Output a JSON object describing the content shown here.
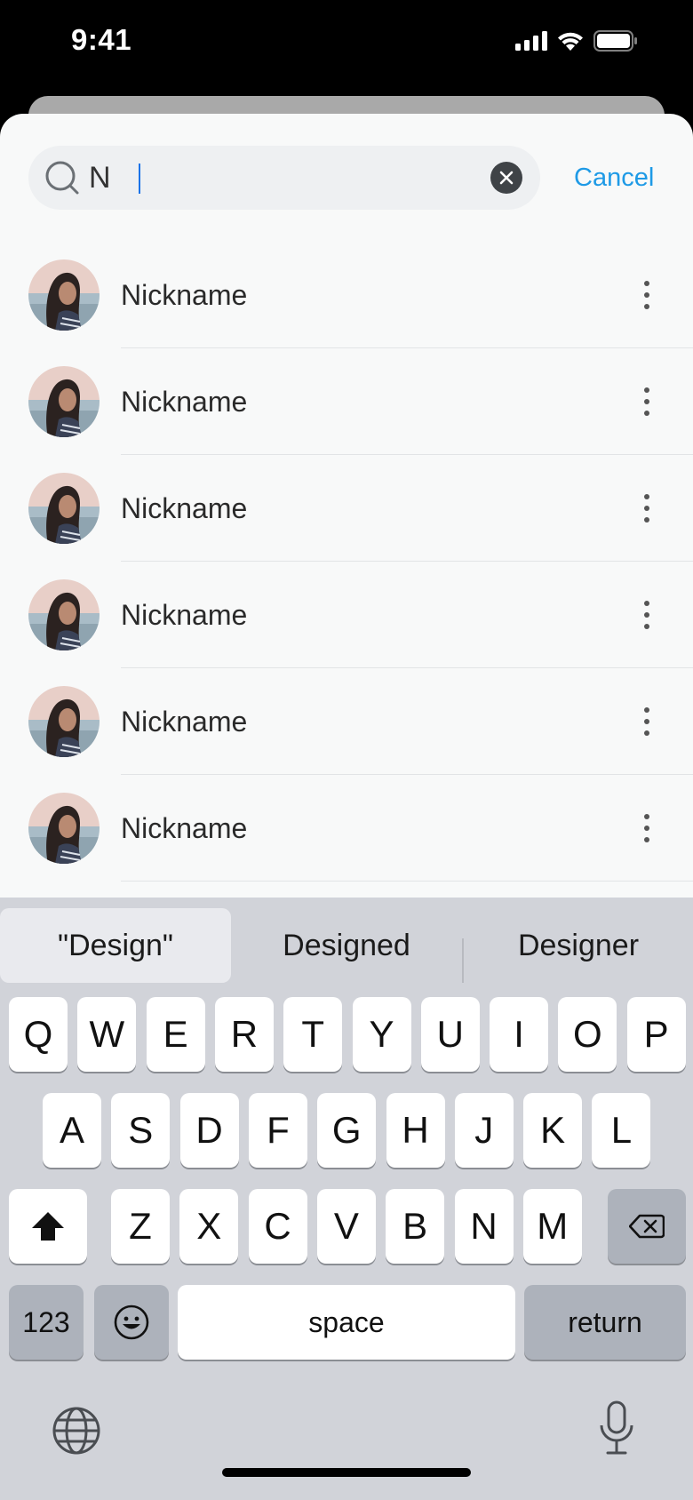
{
  "status_bar": {
    "time": "9:41"
  },
  "search": {
    "value": "N",
    "cancel_label": "Cancel"
  },
  "results": [
    {
      "name": "Nickname"
    },
    {
      "name": "Nickname"
    },
    {
      "name": "Nickname"
    },
    {
      "name": "Nickname"
    },
    {
      "name": "Nickname"
    },
    {
      "name": "Nickname"
    }
  ],
  "keyboard": {
    "suggestions": [
      "\"Design\"",
      "Designed",
      "Designer"
    ],
    "row1": [
      "Q",
      "W",
      "E",
      "R",
      "T",
      "Y",
      "U",
      "I",
      "O",
      "P"
    ],
    "row2": [
      "A",
      "S",
      "D",
      "F",
      "G",
      "H",
      "J",
      "K",
      "L"
    ],
    "row3": [
      "Z",
      "X",
      "C",
      "V",
      "B",
      "N",
      "M"
    ],
    "numbers_label": "123",
    "space_label": "space",
    "return_label": "return"
  }
}
